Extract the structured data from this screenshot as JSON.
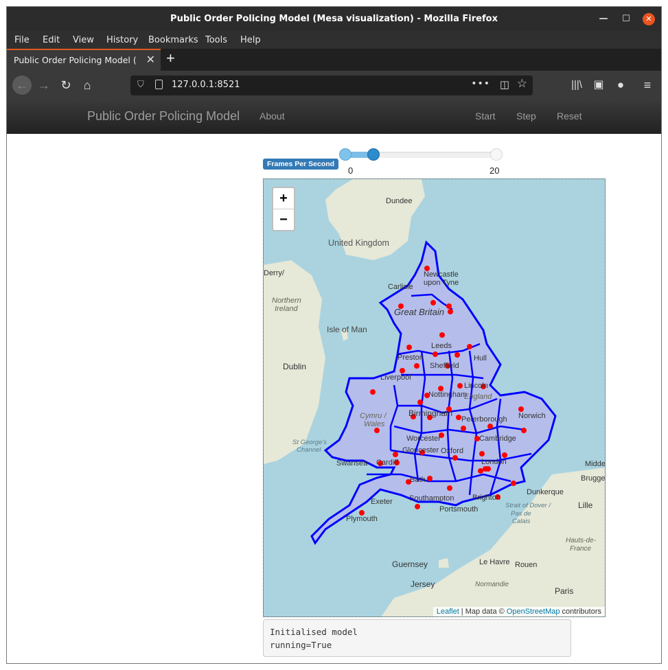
{
  "window": {
    "title": "Public Order Policing Model (Mesa visualization) - Mozilla Firefox"
  },
  "menubar": {
    "items": [
      {
        "label": "File"
      },
      {
        "label": "Edit"
      },
      {
        "label": "View"
      },
      {
        "label": "History"
      },
      {
        "label": "Bookmarks"
      },
      {
        "label": "Tools"
      },
      {
        "label": "Help"
      }
    ]
  },
  "tab": {
    "label": "Public Order Policing Model (Mesa visualization)"
  },
  "address_bar": {
    "url": "127.0.0.1:8521"
  },
  "app_nav": {
    "brand": "Public Order Policing Model",
    "about": "About",
    "start": "Start",
    "step": "Step",
    "reset": "Reset"
  },
  "controls": {
    "fps_label": "Frames Per Second",
    "fps_min": "0",
    "fps_max": "20",
    "fps_value_fraction": 0.15
  },
  "map": {
    "labels": {
      "dundee": "Dundee",
      "uk": "United Kingdom",
      "derry": "Derry/",
      "newcastle_1": "Newcastle",
      "newcastle_2": "upon Tyne",
      "carlisle": "Carlisle",
      "ni_1": "Northern",
      "ni_2": "Ireland",
      "great_britain": "Great Britain",
      "isle_of_man": "Isle of Man",
      "dublin": "Dublin",
      "preston": "Preston",
      "leeds": "Leeds",
      "hull": "Hull",
      "liverpool": "Liverpool",
      "sheffield": "Sheffield",
      "lincoln": "Lincoln",
      "nottingham": "Nottingham",
      "england": "England",
      "wales_1": "Cymru /",
      "wales_2": "Wales",
      "birmingham": "Birmingham",
      "peterborough": "Peterborough",
      "norwich": "Norwich",
      "worcester": "Worcester",
      "cambridge": "Cambridge",
      "stgeorges_1": "St George's",
      "stgeorges_2": "Channel",
      "gloucester": "Gloucester",
      "oxford": "Oxford",
      "london": "London",
      "swansea": "Swansea",
      "cardiff": "Cardiff",
      "middelburg": "Middelburg",
      "brugge": "Brugge",
      "bath": "Bath",
      "dunkerque": "Dunkerque",
      "southampton": "Southampton",
      "brighton": "Brighton",
      "exeter": "Exeter",
      "portsmouth": "Portsmouth",
      "lille": "Lille",
      "strait_1": "Strait of Dover /",
      "strait_2": "Pas de",
      "strait_3": "Calais",
      "plymouth": "Plymouth",
      "hauts_1": "Hauts-de-",
      "hauts_2": "France",
      "guernsey": "Guernsey",
      "le_havre": "Le Havre",
      "rouen": "Rouen",
      "jersey": "Jersey",
      "normandie": "Normandie",
      "paris": "Paris"
    },
    "attribution_leaflet": "Leaflet",
    "attribution_middle": " | Map data © ",
    "attribution_osm": "OpenStreetMap",
    "attribution_end": " contributors"
  },
  "log": {
    "line1": "Initialised model",
    "line2": "running=True"
  },
  "colors": {
    "region_border": "#0000ff",
    "region_fill": "#b9b3f0",
    "agent": "#ff0000",
    "sea": "#aad3df",
    "land": "#e9eae0"
  }
}
